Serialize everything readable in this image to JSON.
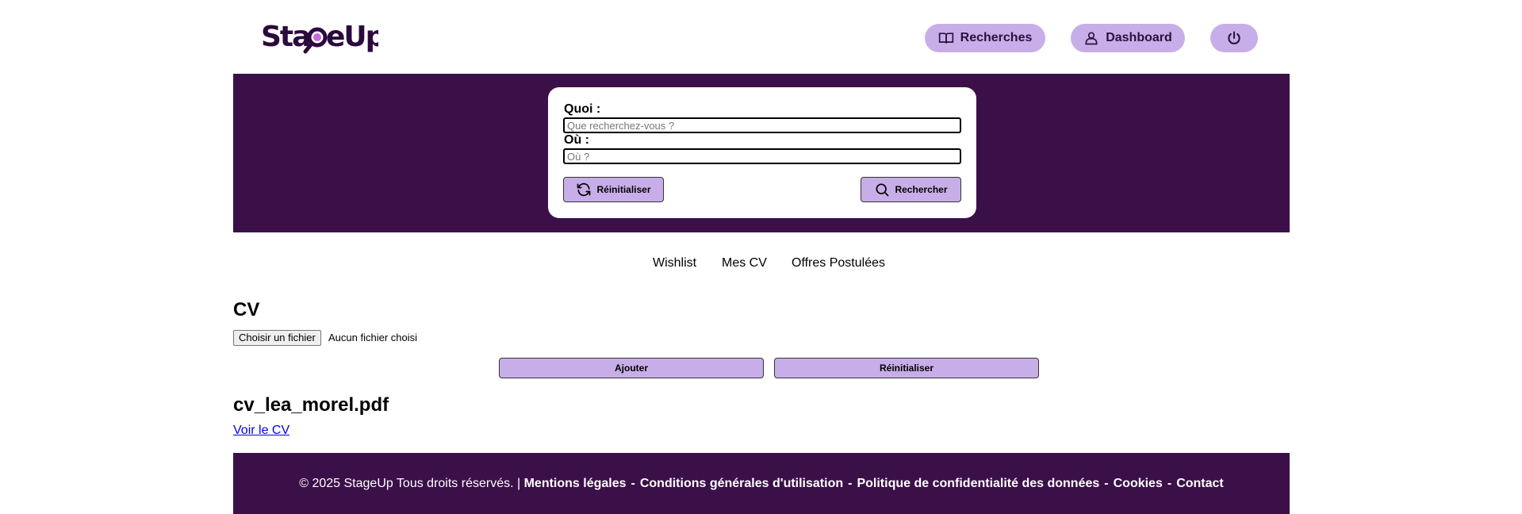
{
  "brand": {
    "logo_text_left": "Sta",
    "logo_text_right": "eUp",
    "accent": "#c8aee8",
    "dark": "#3b1049"
  },
  "header": {
    "nav": [
      {
        "label": "Recherches",
        "icon": "book-icon"
      },
      {
        "label": "Dashboard",
        "icon": "user-icon"
      },
      {
        "label": "",
        "icon": "power-icon"
      }
    ]
  },
  "search": {
    "what_label": "Quoi :",
    "what_placeholder": "Que recherchez-vous ?",
    "where_label": "Où :",
    "where_placeholder": "Où ?",
    "reset_label": "Réinitialiser",
    "search_label": "Rechercher"
  },
  "tabs": [
    "Wishlist",
    "Mes CV",
    "Offres Postulées"
  ],
  "cv": {
    "title": "CV",
    "file_button": "Choisir un fichier",
    "file_status": "Aucun fichier choisi",
    "add_label": "Ajouter",
    "reset_label": "Réinitialiser",
    "file_name": "cv_lea_morel.pdf",
    "view_link": "Voir le CV"
  },
  "footer": {
    "copyright": "© 2025 StageUp Tous droits réservés. |",
    "links": [
      "Mentions légales",
      "Conditions générales d'utilisation",
      "Politique de confidentialité des données",
      "Cookies",
      "Contact"
    ],
    "separator": "-"
  }
}
